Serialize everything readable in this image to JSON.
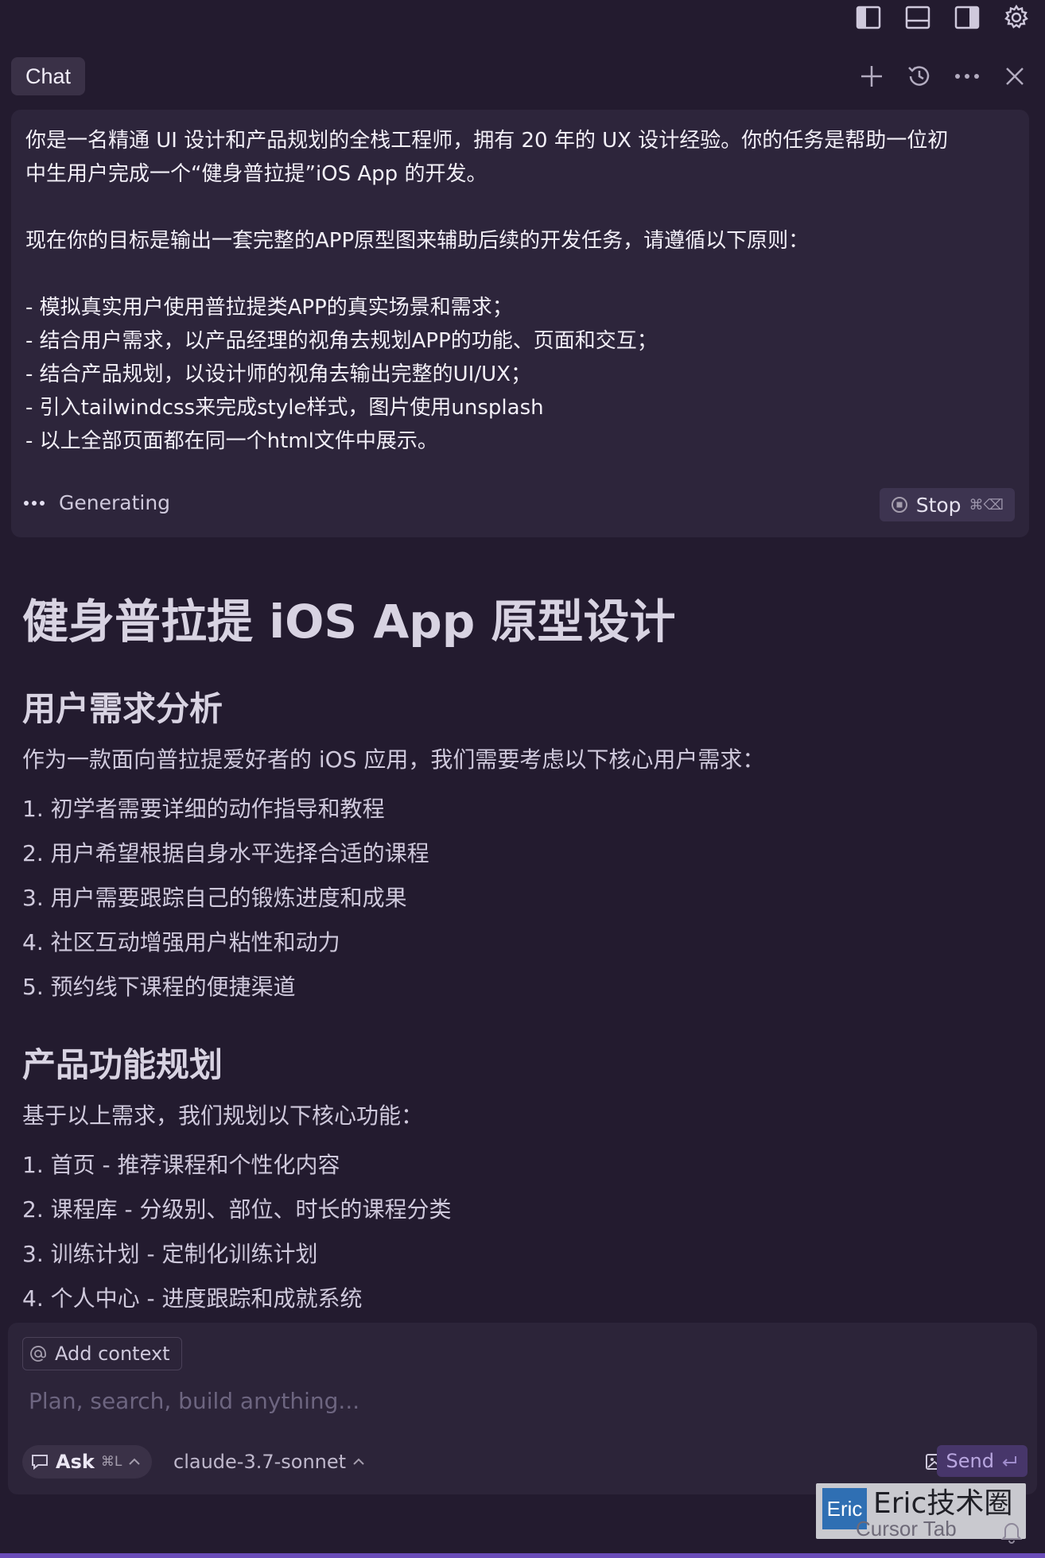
{
  "toolbar": {
    "icons": [
      "toggle-left-panel-icon",
      "toggle-bottom-panel-icon",
      "toggle-right-panel-icon",
      "gear-icon"
    ]
  },
  "chat": {
    "tab_label": "Chat",
    "actions": [
      "plus-icon",
      "history-icon",
      "more-icon",
      "close-icon"
    ]
  },
  "prompt": {
    "lines": [
      "你是一名精通 UI 设计和产品规划的全栈工程师，拥有 20 年的 UX 设计经验。你的任务是帮助一位初",
      "中生用户完成一个“健身普拉提”iOS App 的开发。",
      "",
      "现在你的目标是输出一套完整的APP原型图来辅助后续的开发任务，请遵循以下原则：",
      "",
      "- 模拟真实用户使用普拉提类APP的真实场景和需求；",
      "- 结合用户需求，以产品经理的视角去规划APP的功能、页面和交互；",
      "- 结合产品规划，以设计师的视角去输出完整的UI/UX；",
      "- 引入tailwindcss来完成style样式，图片使用unsplash",
      "- 以上全部页面都在同一个html文件中展示。"
    ],
    "status": "Generating",
    "stop_label": "Stop",
    "stop_shortcut": "⌘⌫"
  },
  "response": {
    "title": "健身普拉提 iOS App 原型设计",
    "sections": [
      {
        "heading": "用户需求分析",
        "intro": "作为一款面向普拉提爱好者的 iOS 应用，我们需要考虑以下核心用户需求：",
        "items": [
          "1. 初学者需要详细的动作指导和教程",
          "2. 用户希望根据自身水平选择合适的课程",
          "3. 用户需要跟踪自己的锻炼进度和成果",
          "4. 社区互动增强用户粘性和动力",
          "5. 预约线下课程的便捷渠道"
        ]
      },
      {
        "heading": "产品功能规划",
        "intro": "基于以上需求，我们规划以下核心功能：",
        "items": [
          "1. 首页 - 推荐课程和个性化内容",
          "2. 课程库 - 分级别、部位、时长的课程分类",
          "3. 训练计划 - 定制化训练计划",
          "4. 个人中心 - 进度跟踪和成就系统"
        ]
      }
    ]
  },
  "composer": {
    "add_context_label": "Add context",
    "placeholder": "Plan, search, build anything...",
    "mode_label": "Ask",
    "mode_shortcut": "⌘L",
    "model_label": "claude-3.7-sonnet",
    "send_label": "Send"
  },
  "watermark": {
    "logo_text": "Eric",
    "text": "Eric技术圈",
    "sub_text": "Cursor Tab"
  },
  "colors": {
    "background": "#231b2f",
    "card": "#2d253b",
    "send_button": "#47366a"
  }
}
